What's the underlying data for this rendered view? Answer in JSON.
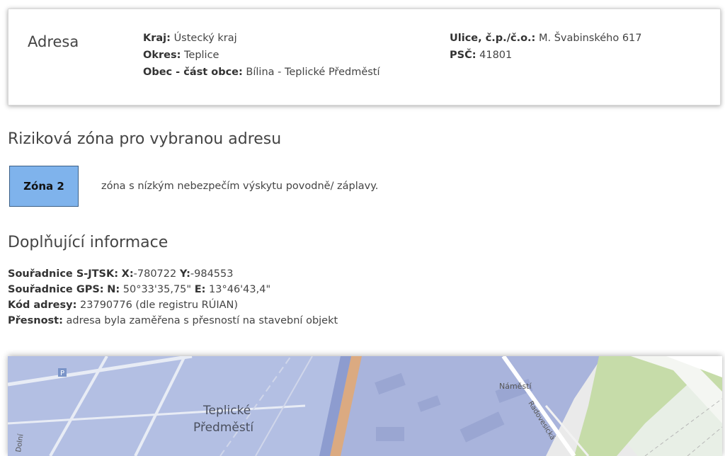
{
  "address_card": {
    "title": "Adresa",
    "kraj_label": "Kraj:",
    "kraj_value": "Ústecký kraj",
    "okres_label": "Okres:",
    "okres_value": "Teplice",
    "obec_label": "Obec - část obce:",
    "obec_value": "Bílina - Teplické Předměstí",
    "ulice_label": "Ulice, č.p./č.o.:",
    "ulice_value": "M. Švabinského 617",
    "psc_label": "PSČ:",
    "psc_value": "41801"
  },
  "risk_zone": {
    "heading": "Riziková zóna pro vybranou adresu",
    "zone_label": "Zóna 2",
    "zone_color": "#7fb3ec",
    "description": "zóna s nízkým nebezpečím výskytu povodně/ záplavy."
  },
  "extra_info": {
    "heading": "Doplňující informace",
    "sjtsk_label": "Souřadnice S-JTSK:",
    "sjtsk_x_label": "X:",
    "sjtsk_x_value": "-780722",
    "sjtsk_y_label": "Y:",
    "sjtsk_y_value": "-984553",
    "gps_label": "Souřadnice GPS:",
    "gps_n_label": "N:",
    "gps_n_value": "50°33'35,75\"",
    "gps_e_label": "E:",
    "gps_e_value": "13°46'43,4\"",
    "kod_label": "Kód adresy:",
    "kod_value": "23790776 (dle registru RÚIAN)",
    "presnost_label": "Přesnost:",
    "presnost_value": "adresa byla zaměřena s přesností na stavební objekt"
  },
  "map": {
    "label_district_1": "Teplické",
    "label_district_2": "Předměstí",
    "label_namesti": "Náměstí",
    "label_street": "Radovesická",
    "label_dolni": "Dolní",
    "parking_symbol": "P"
  }
}
